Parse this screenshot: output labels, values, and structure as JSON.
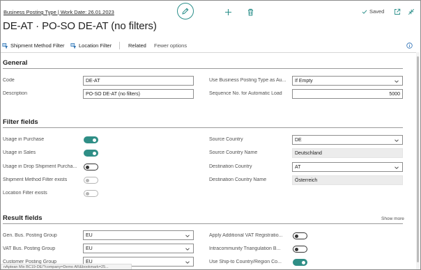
{
  "header": {
    "breadcrumb": "Business Posting Type | Work Date: 26.01.2023",
    "title": "DE-AT · PO-SO DE-AT (no filters)",
    "saved_label": "Saved"
  },
  "actions": {
    "shipment_method_filter": "Shipment Method Filter",
    "location_filter": "Location Filter",
    "related": "Related",
    "fewer_options": "Fewer options"
  },
  "general": {
    "heading": "General",
    "code_label": "Code",
    "code_value": "DE-AT",
    "description_label": "Description",
    "description_value": "PO-SO DE-AT (no filters)",
    "use_bpt_label": "Use Business Posting Type as Au...",
    "use_bpt_value": "If Empty",
    "seq_label": "Sequence No. for Automatic Load",
    "seq_value": "5000"
  },
  "filter_fields": {
    "heading": "Filter fields",
    "usage_purchase_label": "Usage in Purchase",
    "usage_purchase_on": true,
    "usage_sales_label": "Usage in Sales",
    "usage_sales_on": true,
    "usage_drop_label": "Usage in Drop Shipment Purcha...",
    "usage_drop_on": false,
    "shipment_method_exists_label": "Shipment Method Filter exists",
    "shipment_method_exists_on": false,
    "location_filter_exists_label": "Location Filter exists",
    "location_filter_exists_on": false,
    "source_country_label": "Source Country",
    "source_country_value": "DE",
    "source_country_name_label": "Source Country Name",
    "source_country_name_value": "Deutschland",
    "dest_country_label": "Destination Country",
    "dest_country_value": "AT",
    "dest_country_name_label": "Destination Country Name",
    "dest_country_name_value": "Österreich"
  },
  "result_fields": {
    "heading": "Result fields",
    "show_more": "Show more",
    "gen_bus_label": "Gen. Bus. Posting Group",
    "gen_bus_value": "EU",
    "vat_bus_label": "VAT Bus. Posting Group",
    "vat_bus_value": "EU",
    "customer_group_label": "Customer Posting Group",
    "customer_group_value": "EU",
    "apply_vat_label": "Apply Additional VAT Registratio...",
    "apply_vat_on": false,
    "intracommunity_label": "Intracommunity Triangulation B...",
    "intracommunity_on": false,
    "ship_to_label": "Use Ship-to Country/Region Co...",
    "ship_to_on": true
  },
  "status_bar": {
    "url": "nAptean Mix BC19-DE/?company=Demo AR&bookmark=25..."
  },
  "colors": {
    "accent": "#2f8e86",
    "border": "#8d8d8d",
    "readonly_bg": "#ececec"
  },
  "icons": [
    "edit-icon",
    "add-icon",
    "delete-icon",
    "checkmark-icon",
    "open-in-new-icon",
    "collapse-icon",
    "info-icon",
    "shipment-filter-icon",
    "location-filter-icon",
    "chevron-down-icon"
  ]
}
